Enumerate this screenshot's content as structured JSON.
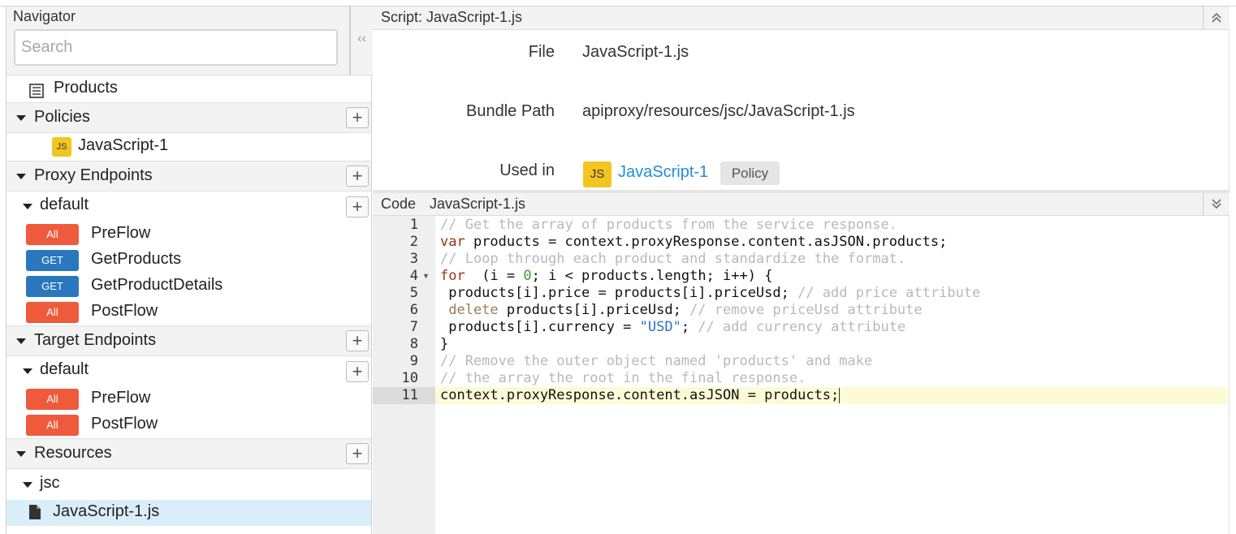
{
  "navigator": {
    "title": "Navigator",
    "search_placeholder": "Search",
    "collapse_glyph": "‹‹",
    "products_label": "Products",
    "policies": {
      "label": "Policies",
      "items": [
        {
          "icon": "JS",
          "label": "JavaScript-1"
        }
      ]
    },
    "proxy_endpoints": {
      "label": "Proxy Endpoints",
      "default": {
        "label": "default",
        "flows": [
          {
            "verb": "All",
            "label": "PreFlow"
          },
          {
            "verb": "GET",
            "label": "GetProducts"
          },
          {
            "verb": "GET",
            "label": "GetProductDetails"
          },
          {
            "verb": "All",
            "label": "PostFlow"
          }
        ]
      }
    },
    "target_endpoints": {
      "label": "Target Endpoints",
      "default": {
        "label": "default",
        "flows": [
          {
            "verb": "All",
            "label": "PreFlow"
          },
          {
            "verb": "All",
            "label": "PostFlow"
          }
        ]
      }
    },
    "resources": {
      "label": "Resources",
      "folder": "jsc",
      "file": "JavaScript-1.js"
    },
    "add_glyph": "+"
  },
  "script_panel": {
    "title": "Script: JavaScript-1.js",
    "collapse_glyph": "⌃",
    "file_label": "File",
    "file_value": "JavaScript-1.js",
    "bundle_label": "Bundle Path",
    "bundle_value": "apiproxy/resources/jsc/JavaScript-1.js",
    "used_in_label": "Used in",
    "used_in_icon": "JS",
    "used_in_link": "JavaScript-1",
    "used_in_tag": "Policy"
  },
  "code_panel": {
    "label": "Code",
    "filename": "JavaScript-1.js",
    "expand_glyph": "⌄",
    "line_numbers": [
      "1",
      "2",
      "3",
      "4",
      "5",
      "6",
      "7",
      "8",
      "9",
      "10",
      "11"
    ],
    "lines": [
      [
        [
          "c-com",
          "// Get the array of products from the service response."
        ]
      ],
      [
        [
          "c-kw",
          "var"
        ],
        [
          "",
          "  products = context.proxyResponse.content.asJSON.products;"
        ]
      ],
      [
        [
          "c-com",
          "// Loop through each product and standardize the format."
        ]
      ],
      [
        [
          "c-kw",
          "for"
        ],
        [
          "",
          "  (i = "
        ],
        [
          "c-num",
          "0"
        ],
        [
          "",
          "; i < products.length; i++) {"
        ]
      ],
      [
        [
          "",
          "  products[i].price = products[i].priceUsd; "
        ],
        [
          "c-com",
          "// add price attribute"
        ]
      ],
      [
        [
          "c-kw2",
          "  delete"
        ],
        [
          "",
          " products[i].priceUsd; "
        ],
        [
          "c-com",
          "// remove priceUsd attribute"
        ]
      ],
      [
        [
          "",
          "  products[i].currency = "
        ],
        [
          "c-str",
          "\"USD\""
        ],
        [
          "",
          "; "
        ],
        [
          "c-com",
          "// add currency attribute"
        ]
      ],
      [
        [
          "",
          "}"
        ]
      ],
      [
        [
          "c-com",
          "// Remove the outer object named 'products' and make"
        ]
      ],
      [
        [
          "c-com",
          "// the array the root in the final response."
        ]
      ],
      [
        [
          "",
          "context.proxyResponse.content.asJSON = products;"
        ]
      ]
    ],
    "active_line": 11
  }
}
